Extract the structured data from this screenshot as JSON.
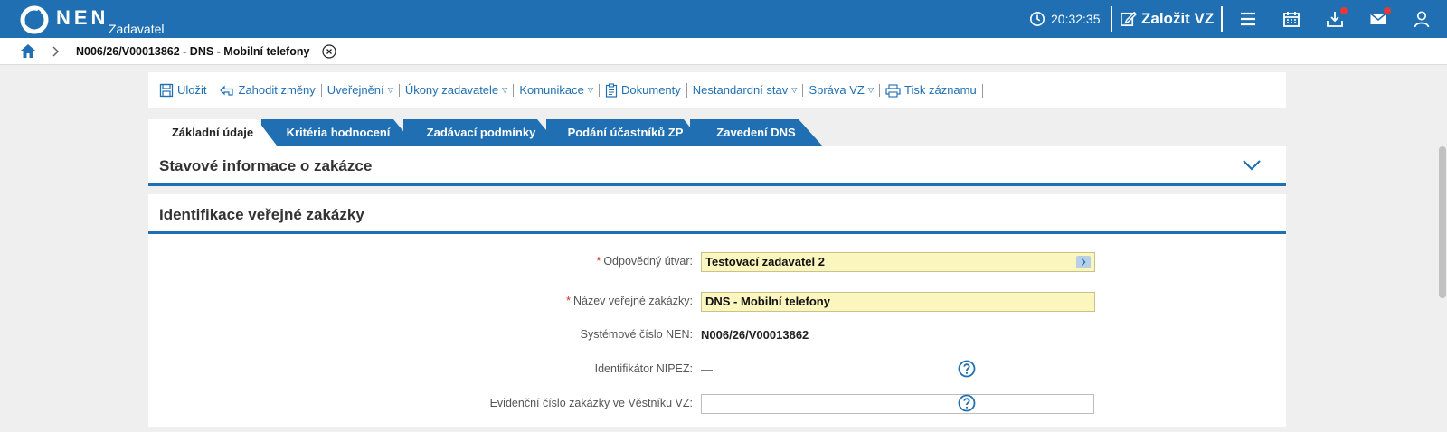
{
  "app": {
    "brand": "NEN",
    "subtitle": "Zadavatel"
  },
  "topbar": {
    "clock": "20:32:35",
    "new_vz_label": "Založit VZ",
    "icons": [
      "clock-icon",
      "edit-icon",
      "menu-icon",
      "calendar-icon",
      "download-icon",
      "mail-icon",
      "user-icon"
    ]
  },
  "breadcrumb": {
    "title": "N006/26/V00013862 - DNS - Mobilní telefony"
  },
  "toolbar": {
    "items": [
      {
        "label": "Uložit"
      },
      {
        "label": "Zahodit změny"
      },
      {
        "label": "Uveřejnění"
      },
      {
        "label": "Úkony zadavatele"
      },
      {
        "label": "Komunikace"
      },
      {
        "label": "Dokumenty"
      },
      {
        "label": "Nestandardní stav"
      },
      {
        "label": "Správa VZ"
      },
      {
        "label": "Tisk záznamu"
      }
    ]
  },
  "tabs": [
    {
      "label": "Základní údaje",
      "active": true
    },
    {
      "label": "Kritéria hodnocení"
    },
    {
      "label": "Zadávací podmínky"
    },
    {
      "label": "Podání účastníků ZP"
    },
    {
      "label": "Zavedení DNS"
    }
  ],
  "panels": {
    "status_title": "Stavové informace o zakázce",
    "identification_title": "Identifikace veřejné zakázky"
  },
  "form": {
    "responsible_unit": {
      "label": "Odpovědný útvar:",
      "value": "Testovací zadavatel 2"
    },
    "contract_name": {
      "label": "Název veřejné zakázky:",
      "value": "DNS - Mobilní telefony"
    },
    "system_number": {
      "label": "Systémové číslo NEN:",
      "value": "N006/26/V00013862"
    },
    "nipez_id": {
      "label": "Identifikátor NIPEZ:",
      "value": "—"
    },
    "journal_number": {
      "label": "Evidenční číslo zakázky ve Věstníku VZ:",
      "value": ""
    }
  },
  "colors": {
    "brand": "#1f6fb2",
    "required": "#d32f2f",
    "field_bg": "#fbf5be"
  }
}
